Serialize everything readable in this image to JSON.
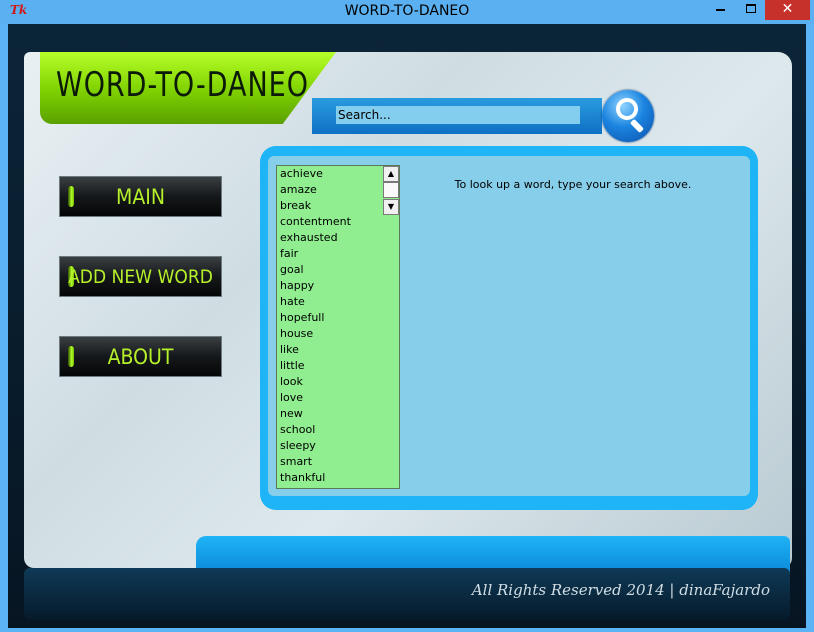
{
  "window": {
    "icon_text": "Tk",
    "title": "WORD-TO-DANEO",
    "close_glyph": "✕"
  },
  "app": {
    "logo": "WORD-TO-DANEO",
    "search": {
      "value": "Search..."
    },
    "search_button_icon": "magnifier-icon",
    "nav": {
      "main": "MAIN",
      "add_new_word": "ADD NEW WORD",
      "about": "ABOUT"
    },
    "words": [
      "achieve",
      "amaze",
      "break",
      "contentment",
      "exhausted",
      "fair",
      "goal",
      "happy",
      "hate",
      "hopefull",
      "house",
      "like",
      "little",
      "look",
      "love",
      "new",
      "school",
      "sleepy",
      "smart",
      "thankful"
    ],
    "hint": "To look up a word, type your search above.",
    "footer": "All Rights Reserved 2014 | dinaFajardo"
  },
  "colors": {
    "accent_green": "#b6f02a",
    "accent_blue": "#1eb4f5",
    "list_bg": "#90ee90",
    "content_bg": "#87ceea"
  }
}
